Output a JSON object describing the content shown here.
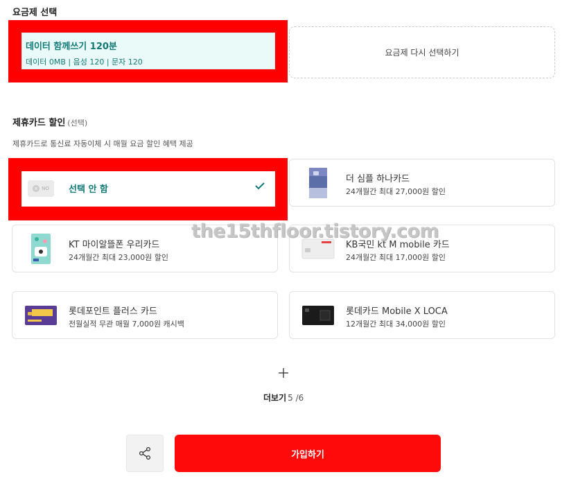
{
  "plan_section": {
    "title": "요금제 선택",
    "selected_plan": {
      "name": "데이터 함께쓰기 120분",
      "detail": "데이터 0MB | 음성 120 | 문자 120"
    },
    "reselect_label": "요금제 다시 선택하기"
  },
  "card_section": {
    "title": "제휴카드 할인",
    "optional": "(선택)",
    "description": "제휴카드로 통신료 자동이체 시 매월 요금 할인 혜택 제공",
    "no_select": {
      "badge": "NO",
      "label": "선택 안 함"
    },
    "cards": [
      {
        "name": "더 심플 하나카드",
        "benefit": "24개월간 최대 27,000원 할인"
      },
      {
        "name": "KT 마이알뜰폰 우리카드",
        "benefit": "24개월간 최대 23,000원 할인"
      },
      {
        "name": "KB국민 kt M mobile 카드",
        "benefit": "24개월간 최대 17,000원 할인"
      },
      {
        "name": "롯데포인트 플러스 카드",
        "benefit": "전월실적 무관 매월 7,000원 캐시백"
      },
      {
        "name": "롯데카드 Mobile X LOCA",
        "benefit": "12개월간 최대 34,000원 할인"
      }
    ]
  },
  "watermark": "the15thfloor.tistory.com",
  "more": {
    "label": "더보기",
    "count": "5 /6"
  },
  "actions": {
    "join_label": "가입하기"
  },
  "colors": {
    "accent_teal": "#117a77",
    "highlight_red": "#ff0000",
    "join_red": "#ff0a0a"
  },
  "icons": {
    "check": "check-icon",
    "plus": "plus-icon",
    "share": "share-icon"
  }
}
